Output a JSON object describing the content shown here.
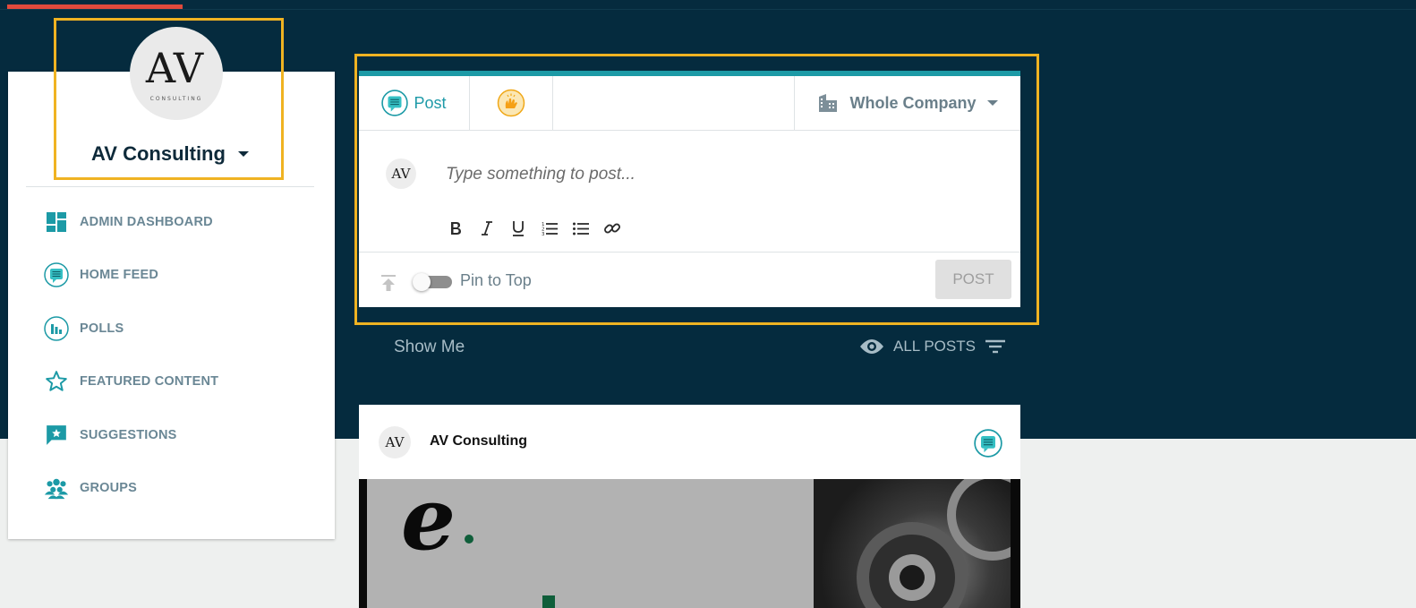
{
  "company": {
    "name": "AV Consulting",
    "logo_monogram": "AV",
    "logo_tagline": "CONSULTING"
  },
  "sidebar": {
    "items": [
      {
        "label": "ADMIN DASHBOARD",
        "icon": "dashboard-icon"
      },
      {
        "label": "HOME FEED",
        "icon": "feed-icon"
      },
      {
        "label": "POLLS",
        "icon": "poll-icon"
      },
      {
        "label": "FEATURED CONTENT",
        "icon": "star-icon"
      },
      {
        "label": "SUGGESTIONS",
        "icon": "suggestion-icon"
      },
      {
        "label": "GROUPS",
        "icon": "groups-icon"
      }
    ]
  },
  "composer": {
    "tab_post": "Post",
    "audience": "Whole Company",
    "placeholder": "Type something to post...",
    "format_buttons": [
      "bold",
      "italic",
      "underline",
      "ordered-list",
      "bullet-list",
      "link"
    ],
    "pin_label": "Pin to Top",
    "pin_enabled": false,
    "post_button": "POST"
  },
  "filter": {
    "show_me": "Show Me",
    "label": "ALL POSTS"
  },
  "feed": {
    "author": "AV Consulting"
  },
  "colors": {
    "header_bg": "#052b3e",
    "accent": "#1c9aa6",
    "highlight": "#f0b322",
    "progress": "#e04a3c"
  }
}
